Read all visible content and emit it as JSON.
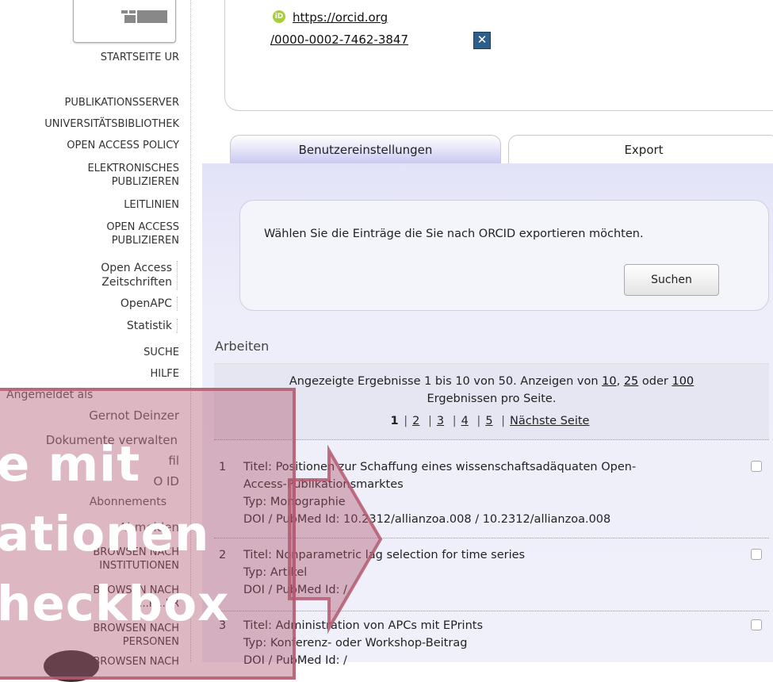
{
  "sidebar": {
    "home_label": "STARTSEITE UR",
    "nav": [
      "PUBLIKATIONSSERVER",
      "UNIVERSITÄTSBIBLIOTHEK",
      "OPEN ACCESS POLICY"
    ],
    "elektronisches": [
      "ELEKTRONISCHES",
      "PUBLIZIEREN"
    ],
    "leitlinien": "LEITLINIEN",
    "open_access_pub": [
      "OPEN ACCESS",
      "PUBLIZIEREN"
    ],
    "open_access_zeit": [
      "Open Access",
      "Zeitschriften"
    ],
    "openapc": "OpenAPC",
    "statistik": "Statistik",
    "suche": "SUCHE",
    "hilfe": "HILFE",
    "logged_in_as": "Angemeldet als",
    "user_name": "Gernot Deinzer",
    "dokumente": "Dokumente verwalten",
    "profil_fragment": "fil",
    "orcid_fragment": "O   ID",
    "abonnements": "Abonnements",
    "abmelden": "Abmelden",
    "browse_inst": [
      "BROWSEN NACH",
      "INSTITUTIONEN"
    ],
    "browse_fach": [
      "BROWSEN NACH",
      "...R...ER"
    ],
    "browse_pers": [
      "BROWSEN NACH",
      "PERSONEN"
    ],
    "browse_more": "BROWSEN NACH"
  },
  "orcid": {
    "link_line1": "https://orcid.org",
    "link_line2": "/0000-0002-7462-3847",
    "icon": "iD",
    "remove_icon": "close-icon"
  },
  "tabs": {
    "settings": "Benutzereinstellungen",
    "export": "Export"
  },
  "export": {
    "instruction": "Wählen Sie die Einträge die Sie nach ORCID exportieren möchten.",
    "search_button": "Suchen"
  },
  "results": {
    "section_title": "Arbeiten",
    "summary_pre": "Angezeigte Ergebnisse 1 bis 10 von 50. Anzeigen von ",
    "per_page": [
      "10",
      "25",
      "100"
    ],
    "summary_mid1": ", ",
    "summary_mid2": " oder ",
    "summary_post": "Ergebnissen pro Seite.",
    "pages": [
      "1",
      "2",
      "3",
      "4",
      "5"
    ],
    "next_page": "Nächste Seite"
  },
  "items": [
    {
      "num": "1",
      "title": "Titel: Positionen zur Schaffung eines wissenschaftsadäquaten Open-",
      "title2": "Access-Publikationsmarktes",
      "type": "Typ: Monographie",
      "doi": "DOI / PubMed Id: 10.2312/allianzoa.008 / 10.2312/allianzoa.008"
    },
    {
      "num": "2",
      "title": "Titel: Nonparametric lag selection for time series",
      "type": "Typ: Artikel",
      "doi": "DOI / PubMed Id: /"
    },
    {
      "num": "3",
      "title": "Titel: Administration von APCs mit EPrints",
      "type": "Typ: Konferenz- oder Workshop-Beitrag",
      "doi": "DOI / PubMed Id: /"
    }
  ],
  "overlay": {
    "line1": "e mit",
    "line2": "ationen",
    "line3": "heckbox"
  },
  "colors": {
    "tab_gradient_end": "#c9c8f2",
    "panel_bg": "#eeeefa",
    "overlay": "#af556e",
    "orcid_green": "#a6ce39",
    "remove_button": "#2d5f88"
  }
}
